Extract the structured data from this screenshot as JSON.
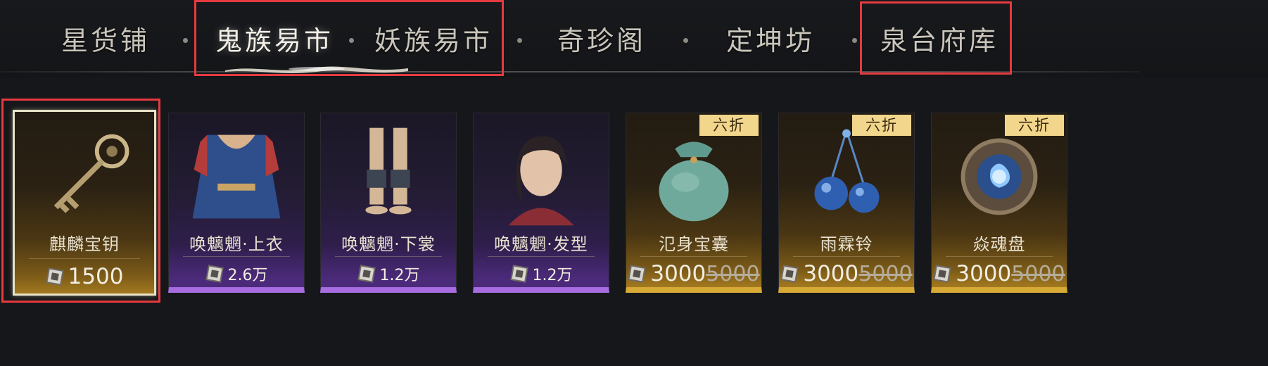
{
  "tabs": [
    {
      "label": "星货铺",
      "active": false
    },
    {
      "label": "鬼族易市",
      "active": true
    },
    {
      "label": "妖族易市",
      "active": false
    },
    {
      "label": "奇珍阁",
      "active": false
    },
    {
      "label": "定坤坊",
      "active": false
    },
    {
      "label": "泉台府库",
      "active": false
    }
  ],
  "colors": {
    "highlight": "#e53a3f",
    "gold_rarity": "#d7a935",
    "purple_rarity": "#a66ce0",
    "badge": "#f1d68c"
  },
  "items": [
    {
      "name": "麒麟宝钥",
      "price": "1500",
      "rarity": "gold",
      "selected": true,
      "icon": "golden-key-icon"
    },
    {
      "name": "唤魑魍·上衣",
      "price": "2.6万",
      "rarity": "purple",
      "icon": "robe-top-icon"
    },
    {
      "name": "唤魑魍·下裳",
      "price": "1.2万",
      "rarity": "purple",
      "icon": "lower-garment-icon"
    },
    {
      "name": "唤魑魍·发型",
      "price": "1.2万",
      "rarity": "purple",
      "icon": "hairstyle-icon"
    },
    {
      "name": "氾身宝囊",
      "price": "3000",
      "old_price": "5000",
      "badge": "六折",
      "rarity": "gold",
      "icon": "treasure-pouch-icon"
    },
    {
      "name": "雨霖铃",
      "price": "3000",
      "old_price": "5000",
      "badge": "六折",
      "rarity": "gold",
      "icon": "blue-bells-icon"
    },
    {
      "name": "焱魂盘",
      "price": "3000",
      "old_price": "5000",
      "badge": "六折",
      "rarity": "gold",
      "icon": "soul-disc-icon"
    }
  ],
  "currency_icon": "jade-token-icon"
}
